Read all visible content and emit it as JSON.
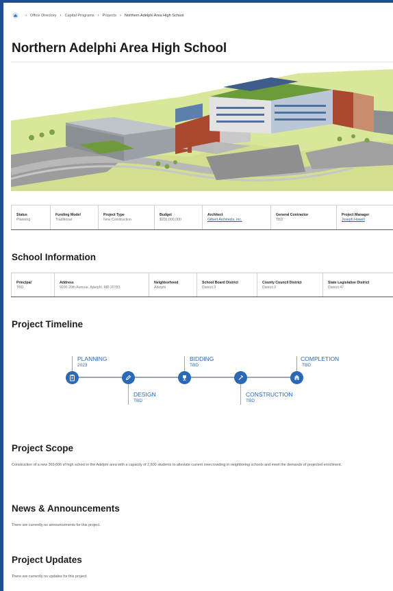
{
  "breadcrumb": {
    "items": [
      "Office Directory",
      "Capital Programs",
      "Projects",
      "Northern Adelphi Area High School"
    ]
  },
  "page": {
    "title": "Northern Adelphi Area High School"
  },
  "project_info": [
    {
      "label": "Status",
      "value": "Planning",
      "link": false
    },
    {
      "label": "Funding Model",
      "value": "Traditional",
      "link": false
    },
    {
      "label": "Project Type",
      "value": "New Construction",
      "link": false
    },
    {
      "label": "Budget",
      "value": "$200,000,000",
      "link": false
    },
    {
      "label": "Architect",
      "value": "Gilbert Architects, Inc.",
      "link": true
    },
    {
      "label": "General Contractor",
      "value": "TBD",
      "link": false
    },
    {
      "label": "Project Manager",
      "value": "Joseph Howell",
      "link": true
    }
  ],
  "school_information": {
    "heading": "School Information",
    "fields": [
      {
        "label": "Principal",
        "value": "TBD"
      },
      {
        "label": "Address",
        "value": "9200 20th Avenue, Adelphi, MD 20783"
      },
      {
        "label": "Neighborhood",
        "value": "Adelphi"
      },
      {
        "label": "School Board District",
        "value": "District 3"
      },
      {
        "label": "County Council District",
        "value": "District 2"
      },
      {
        "label": "State Legislative District",
        "value": "District 47"
      }
    ]
  },
  "timeline": {
    "heading": "Project Timeline",
    "stages": [
      {
        "name": "PLANNING",
        "date": "2023",
        "icon": "clipboard-icon"
      },
      {
        "name": "DESIGN",
        "date": "TBD",
        "icon": "pencil-icon"
      },
      {
        "name": "BIDDING",
        "date": "TBD",
        "icon": "trophy-icon"
      },
      {
        "name": "CONSTRUCTION",
        "date": "TBD",
        "icon": "hammer-icon"
      },
      {
        "name": "COMPLETION",
        "date": "TBD",
        "icon": "school-building-icon"
      }
    ],
    "accent_color": "#2a68b8"
  },
  "scope": {
    "heading": "Project Scope",
    "text": "Construction of a new 369,606 sf high school in the Adelphi area with a capacity of 2,600 students to alleviate current overcrowding in neighboring schools and meet the demands of projected enrollment."
  },
  "news": {
    "heading": "News & Announcements",
    "text": "There are currently no announcements for this project."
  },
  "updates": {
    "heading": "Project Updates",
    "text": "There are currently no updates for this project."
  },
  "colors": {
    "frame": "#1f4e96",
    "link": "#1f5bb5"
  }
}
